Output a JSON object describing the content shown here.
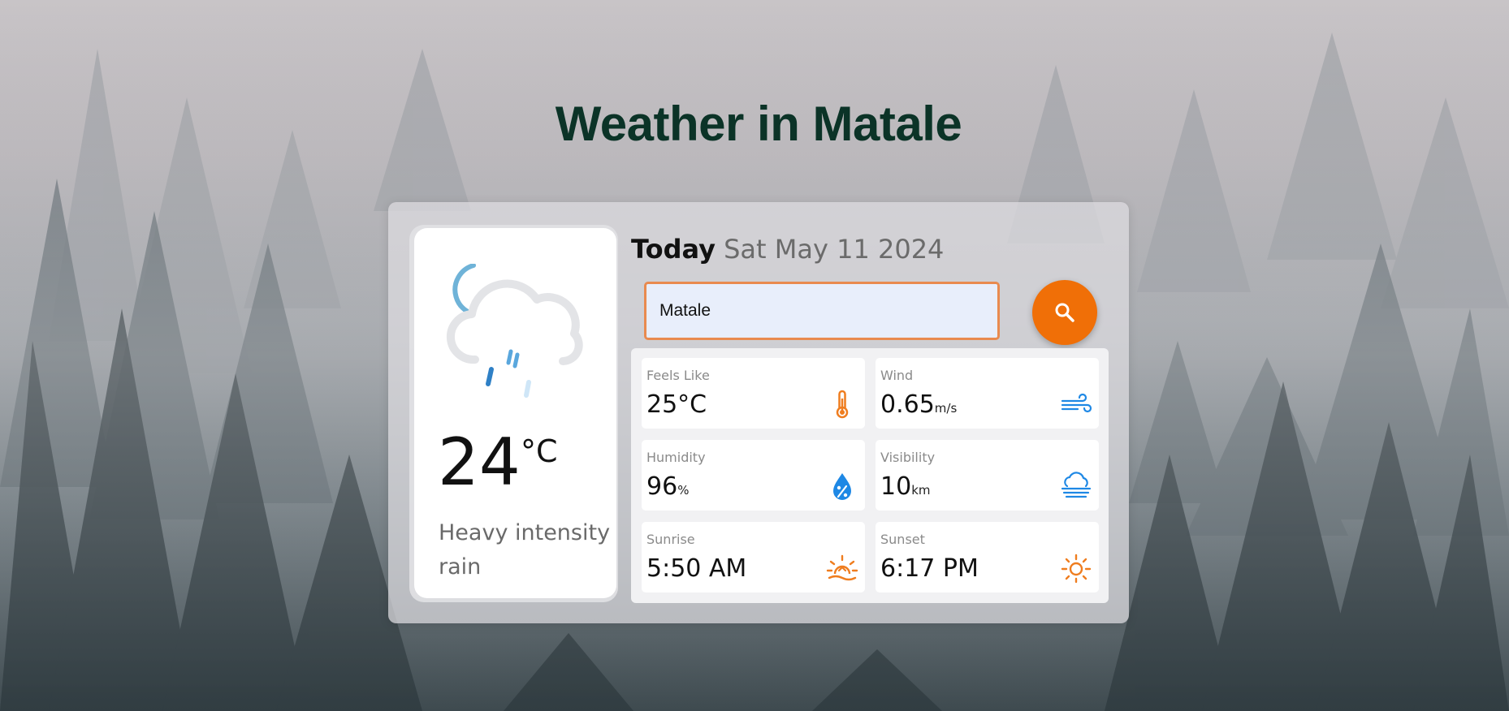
{
  "page": {
    "title": "Weather in Matale"
  },
  "current": {
    "icon": "cloud-moon-rain-icon",
    "temperature": "24",
    "unit": "°C",
    "condition": "Heavy intensity rain"
  },
  "header": {
    "today_label": "Today",
    "date": "Sat May 11 2024"
  },
  "search": {
    "value": "Matale",
    "placeholder": "",
    "button_icon": "search-icon"
  },
  "stats": {
    "feels_like": {
      "label": "Feels Like",
      "value": "25°C",
      "unit": "",
      "icon": "thermometer-icon"
    },
    "wind": {
      "label": "Wind",
      "value": "0.65",
      "unit": "m/s",
      "icon": "wind-icon"
    },
    "humidity": {
      "label": "Humidity",
      "value": "96",
      "unit": "%",
      "icon": "humidity-drop-icon"
    },
    "visibility": {
      "label": "Visibility",
      "value": "10",
      "unit": "km",
      "icon": "fog-icon"
    },
    "sunrise": {
      "label": "Sunrise",
      "value": "5:50 AM",
      "unit": "",
      "icon": "sunrise-icon"
    },
    "sunset": {
      "label": "Sunset",
      "value": "6:17 PM",
      "unit": "",
      "icon": "sunset-icon"
    }
  },
  "colors": {
    "title": "#0b3327",
    "accent": "#f06f07",
    "search_border": "#e98a4f",
    "humidity_icon": "#1e88e5",
    "wind_icon": "#1e88e5"
  }
}
